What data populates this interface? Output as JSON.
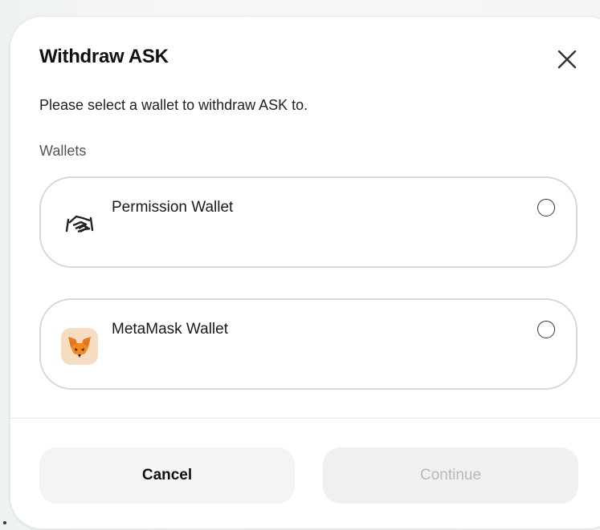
{
  "dialog": {
    "title": "Withdraw ASK",
    "subtitle": "Please select a wallet to withdraw ASK to.",
    "section_label": "Wallets",
    "close_icon": "close-icon"
  },
  "wallets": [
    {
      "name": "Permission Wallet",
      "icon": "handshake-icon",
      "selected": false
    },
    {
      "name": "MetaMask Wallet",
      "icon": "metamask-fox-icon",
      "selected": false
    }
  ],
  "footer": {
    "cancel_label": "Cancel",
    "continue_label": "Continue",
    "continue_enabled": false
  },
  "colors": {
    "card_border": "#d8d8d8",
    "button_bg": "#f4f4f4",
    "disabled_text": "#b9b9b9",
    "fox_orange": "#e2761b"
  }
}
